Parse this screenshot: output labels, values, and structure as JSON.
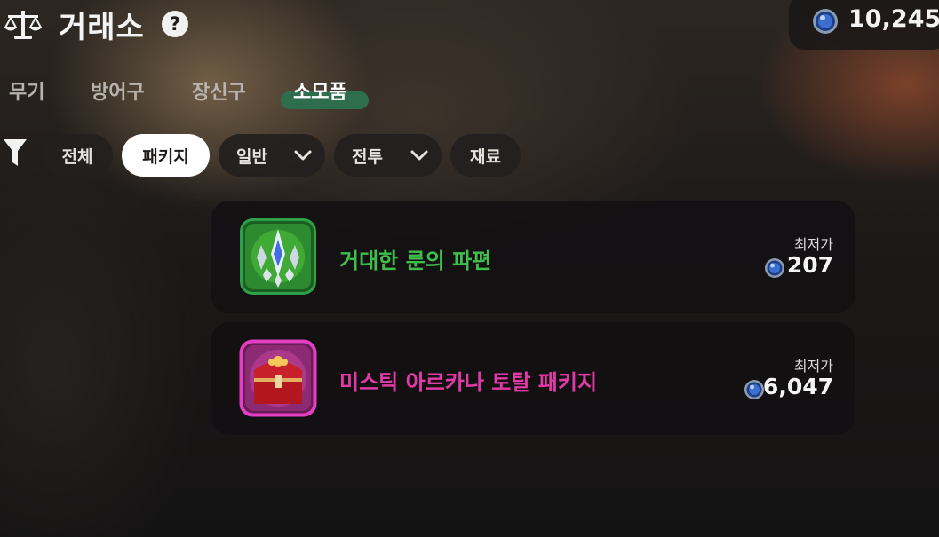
{
  "header": {
    "title": "거래소",
    "help_symbol": "?",
    "currency_value": "10,245",
    "icons": {
      "title": "scales-icon",
      "help": "help-icon",
      "currency": "blue-orb-coin-icon"
    }
  },
  "tabs": [
    {
      "label": "무기",
      "active": false
    },
    {
      "label": "방어구",
      "active": false
    },
    {
      "label": "장신구",
      "active": false
    },
    {
      "label": "소모품",
      "active": true
    }
  ],
  "filters": [
    {
      "label": "전체",
      "active": false,
      "dropdown": false
    },
    {
      "label": "패키지",
      "active": true,
      "dropdown": false
    },
    {
      "label": "일반",
      "active": false,
      "dropdown": true
    },
    {
      "label": "전투",
      "active": false,
      "dropdown": true
    },
    {
      "label": "재료",
      "active": false,
      "dropdown": false
    }
  ],
  "items": [
    {
      "name": "거대한 룬의 파편",
      "price_label": "최저가",
      "price": "207",
      "name_color": "#3fbf4a",
      "icon": "rune-shard-icon",
      "frame_color": "#2fa04a"
    },
    {
      "name": "미스틱 아르카나 토탈 패키지",
      "price_label": "최저가",
      "price": "6,047",
      "name_color": "#e03aa6",
      "icon": "red-treasure-chest-icon",
      "frame_color": "#e23fc2"
    }
  ],
  "colors": {
    "accent_tab": "#2f6e4c",
    "chip_active": "#ffffff"
  }
}
